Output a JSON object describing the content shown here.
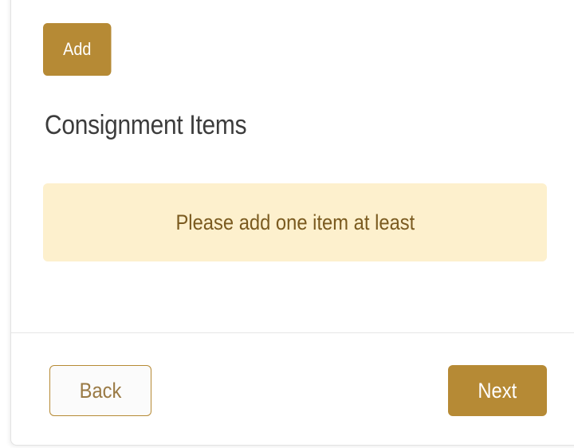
{
  "toolbar": {
    "add_label": "Add"
  },
  "section": {
    "title": "Consignment Items"
  },
  "alert": {
    "message": "Please add one item at least",
    "background_color": "#fdf0cd",
    "text_color": "#7a5a1f"
  },
  "footer": {
    "back_label": "Back",
    "next_label": "Next"
  },
  "colors": {
    "accent": "#b68a35"
  }
}
